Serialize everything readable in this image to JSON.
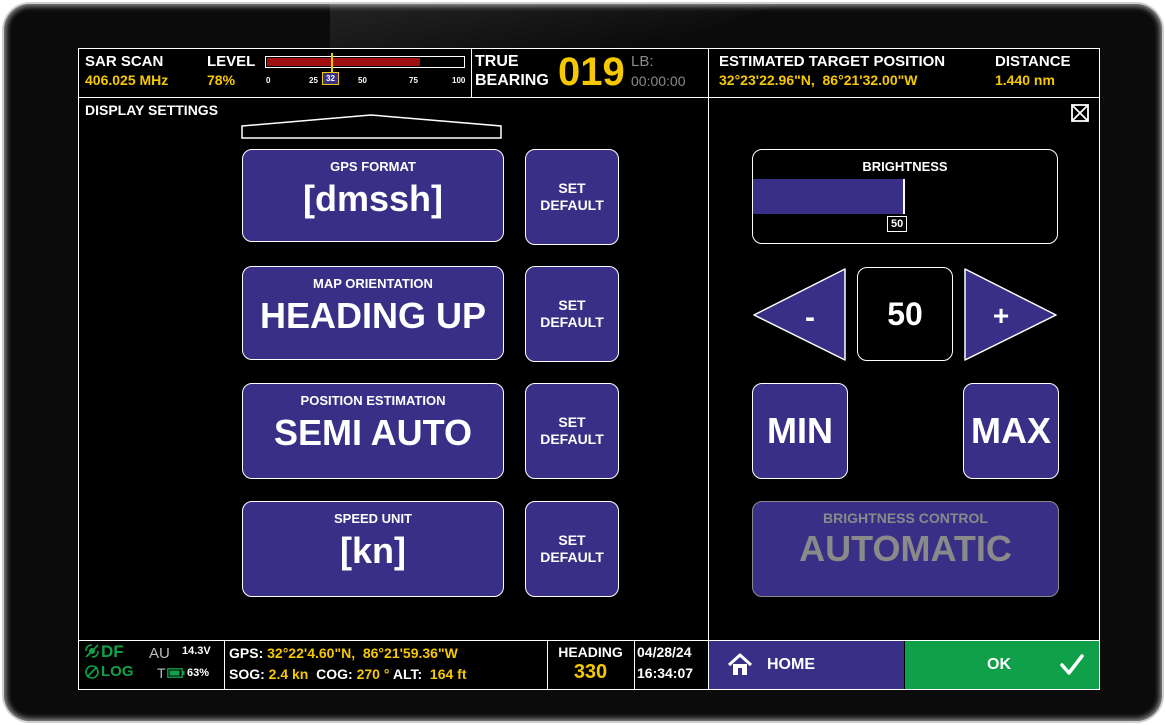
{
  "status": {
    "sar_label": "SAR SCAN",
    "frequency": "406.025 MHz",
    "level_label": "LEVEL",
    "level_percent": "78%",
    "level_value": 78,
    "level_ticks": [
      "0",
      "25",
      "32",
      "50",
      "75",
      "100"
    ],
    "level_marker": "32",
    "true_label": "TRUE",
    "bearing_label": "BEARING",
    "bearing_value": "019",
    "lb_label": "LB:",
    "lb_time": "00:00:00",
    "target_label": "ESTIMATED TARGET POSITION",
    "target_position": "32°23'22.96\"N,  86°21'32.00\"W",
    "distance_label": "DISTANCE",
    "distance_value": "1.440 nm"
  },
  "left_panel": {
    "title": "DISPLAY SETTINGS",
    "settings": [
      {
        "caption": "GPS FORMAT",
        "value": "[dmssh]",
        "set_label_1": "SET",
        "set_label_2": "DEFAULT"
      },
      {
        "caption": "MAP ORIENTATION",
        "value": "HEADING UP",
        "set_label_1": "SET",
        "set_label_2": "DEFAULT"
      },
      {
        "caption": "POSITION ESTIMATION",
        "value": "SEMI AUTO",
        "set_label_1": "SET",
        "set_label_2": "DEFAULT"
      },
      {
        "caption": "SPEED UNIT",
        "value": "[kn]",
        "set_label_1": "SET",
        "set_label_2": "DEFAULT"
      }
    ]
  },
  "right_panel": {
    "close_icon": "close-box-icon",
    "brightness_label": "BRIGHTNESS",
    "brightness_value": "50",
    "brightness_level": 50,
    "minus_label": "-",
    "plus_label": "+",
    "min_label": "MIN",
    "max_label": "MAX",
    "control_label": "BRIGHTNESS CONTROL",
    "control_value": "AUTOMATIC"
  },
  "footer": {
    "df_label": "DF",
    "log_label": "LOG",
    "au_label": "AU",
    "voltage": "14.3V",
    "t_label": "T",
    "battery": "63%",
    "gps_label": "GPS:",
    "gps_value": "32°22'4.60\"N,  86°21'59.36\"W",
    "sog_label": "SOG:",
    "sog_value": "2.4 kn",
    "cog_label": "COG:",
    "cog_value": "270 °",
    "alt_label": "ALT:",
    "alt_value": "164 ft",
    "heading_label": "HEADING",
    "heading_value": "330",
    "date": "04/28/24",
    "time": "16:34:07",
    "home_label": "HOME",
    "ok_label": "OK"
  },
  "colors": {
    "accent_yellow": "#f5c800",
    "button_purple": "#3a2f86",
    "home_purple": "#3a2f86",
    "ok_green": "#10a04a",
    "level_red": "#a01010",
    "disabled_grey": "#8a8a8a"
  }
}
